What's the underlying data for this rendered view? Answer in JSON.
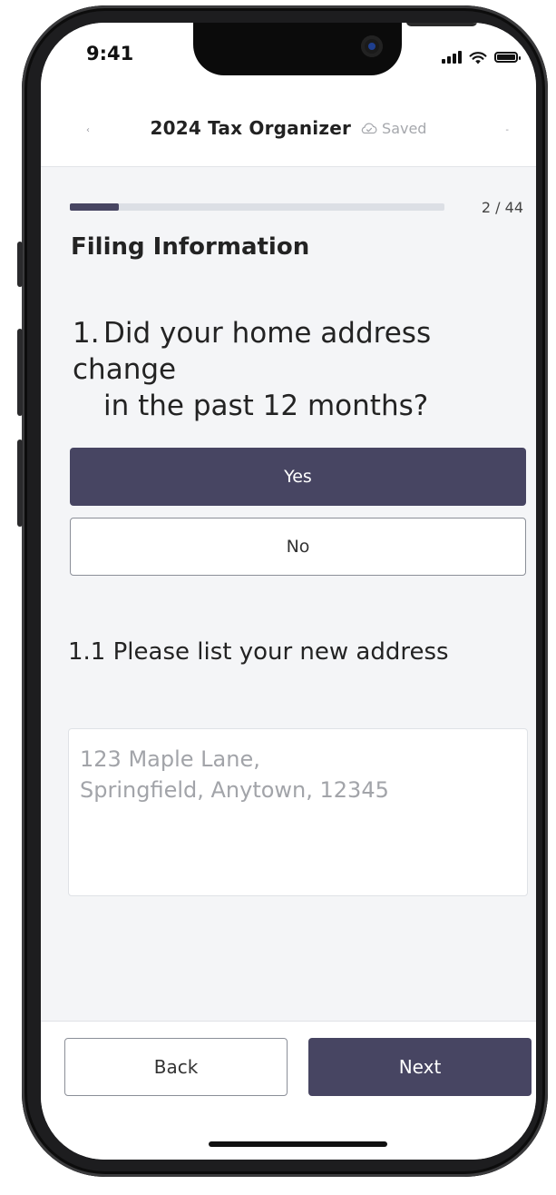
{
  "status_bar": {
    "time": "9:41"
  },
  "header": {
    "back_glyph": "‹",
    "title": "2024 Tax Organizer",
    "saved_label": "Saved",
    "saved_icon": "cloud-check-icon",
    "menu_glyph": "-"
  },
  "progress": {
    "current": 2,
    "total": 44,
    "label": "2 / 44"
  },
  "section": {
    "title": "Filing Information"
  },
  "question": {
    "number": "1.",
    "line1": "Did your home address change",
    "line2": "in the past 12 months?",
    "options": {
      "yes": "Yes",
      "no": "No"
    },
    "selected": "Yes"
  },
  "sub_question": {
    "label": "1.1 Please list your new address",
    "placeholder": "123 Maple Lane,\nSpringfield, Anytown, 12345"
  },
  "footer": {
    "back_label": "Back",
    "next_label": "Next"
  },
  "colors": {
    "accent": "#474562",
    "background": "#f4f5f7",
    "track": "#dcdfe5"
  }
}
